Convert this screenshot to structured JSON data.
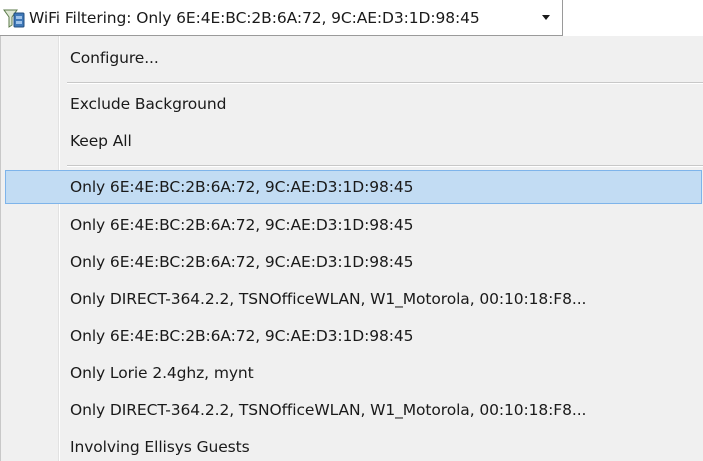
{
  "dropdown": {
    "label": "WiFi Filtering: Only 6E:4E:BC:2B:6A:72, 9C:AE:D3:1D:98:45",
    "icon": "filter-icon"
  },
  "menu": {
    "items": [
      {
        "label": "Configure..."
      },
      {
        "label": "Exclude Background"
      },
      {
        "label": "Keep All"
      },
      {
        "label": "Only 6E:4E:BC:2B:6A:72, 9C:AE:D3:1D:98:45",
        "highlighted": true
      },
      {
        "label": "Only 6E:4E:BC:2B:6A:72, 9C:AE:D3:1D:98:45"
      },
      {
        "label": "Only 6E:4E:BC:2B:6A:72, 9C:AE:D3:1D:98:45"
      },
      {
        "label": "Only DIRECT-364.2.2, TSNOfficeWLAN, W1_Motorola, 00:10:18:F8..."
      },
      {
        "label": "Only 6E:4E:BC:2B:6A:72, 9C:AE:D3:1D:98:45"
      },
      {
        "label": "Only Lorie 2.4ghz, mynt"
      },
      {
        "label": "Only DIRECT-364.2.2, TSNOfficeWLAN, W1_Motorola, 00:10:18:F8..."
      },
      {
        "label": "Involving Ellisys Guests"
      }
    ]
  },
  "colors": {
    "highlight": "#c2dcf3",
    "highlight_border": "#7eb4ea",
    "menu_background": "#f0f0f0"
  }
}
